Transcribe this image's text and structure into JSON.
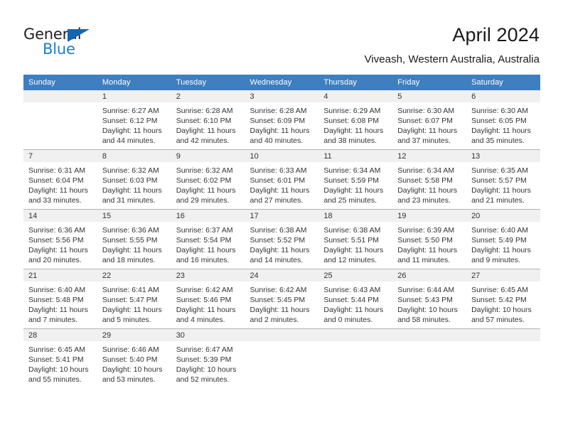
{
  "brand": {
    "name_top": "General",
    "name_bottom": "Blue",
    "accent_color": "#1565b0",
    "accent_color_text": "#1a7ed0"
  },
  "header": {
    "title": "April 2024",
    "subtitle": "Viveash, Western Australia, Australia"
  },
  "theme": {
    "header_row_bg": "#3d7fc1",
    "daynum_band_bg": "#f0f0f0",
    "cell_bg": "#ffffff",
    "border_color": "#b5b5b5",
    "text_color": "#333333"
  },
  "weekday_headers": [
    "Sunday",
    "Monday",
    "Tuesday",
    "Wednesday",
    "Thursday",
    "Friday",
    "Saturday"
  ],
  "weeks": [
    [
      {
        "day": "",
        "sunrise": "",
        "sunset": "",
        "daylight_line1": "",
        "daylight_line2": ""
      },
      {
        "day": "1",
        "sunrise": "Sunrise: 6:27 AM",
        "sunset": "Sunset: 6:12 PM",
        "daylight_line1": "Daylight: 11 hours",
        "daylight_line2": "and 44 minutes."
      },
      {
        "day": "2",
        "sunrise": "Sunrise: 6:28 AM",
        "sunset": "Sunset: 6:10 PM",
        "daylight_line1": "Daylight: 11 hours",
        "daylight_line2": "and 42 minutes."
      },
      {
        "day": "3",
        "sunrise": "Sunrise: 6:28 AM",
        "sunset": "Sunset: 6:09 PM",
        "daylight_line1": "Daylight: 11 hours",
        "daylight_line2": "and 40 minutes."
      },
      {
        "day": "4",
        "sunrise": "Sunrise: 6:29 AM",
        "sunset": "Sunset: 6:08 PM",
        "daylight_line1": "Daylight: 11 hours",
        "daylight_line2": "and 38 minutes."
      },
      {
        "day": "5",
        "sunrise": "Sunrise: 6:30 AM",
        "sunset": "Sunset: 6:07 PM",
        "daylight_line1": "Daylight: 11 hours",
        "daylight_line2": "and 37 minutes."
      },
      {
        "day": "6",
        "sunrise": "Sunrise: 6:30 AM",
        "sunset": "Sunset: 6:05 PM",
        "daylight_line1": "Daylight: 11 hours",
        "daylight_line2": "and 35 minutes."
      }
    ],
    [
      {
        "day": "7",
        "sunrise": "Sunrise: 6:31 AM",
        "sunset": "Sunset: 6:04 PM",
        "daylight_line1": "Daylight: 11 hours",
        "daylight_line2": "and 33 minutes."
      },
      {
        "day": "8",
        "sunrise": "Sunrise: 6:32 AM",
        "sunset": "Sunset: 6:03 PM",
        "daylight_line1": "Daylight: 11 hours",
        "daylight_line2": "and 31 minutes."
      },
      {
        "day": "9",
        "sunrise": "Sunrise: 6:32 AM",
        "sunset": "Sunset: 6:02 PM",
        "daylight_line1": "Daylight: 11 hours",
        "daylight_line2": "and 29 minutes."
      },
      {
        "day": "10",
        "sunrise": "Sunrise: 6:33 AM",
        "sunset": "Sunset: 6:01 PM",
        "daylight_line1": "Daylight: 11 hours",
        "daylight_line2": "and 27 minutes."
      },
      {
        "day": "11",
        "sunrise": "Sunrise: 6:34 AM",
        "sunset": "Sunset: 5:59 PM",
        "daylight_line1": "Daylight: 11 hours",
        "daylight_line2": "and 25 minutes."
      },
      {
        "day": "12",
        "sunrise": "Sunrise: 6:34 AM",
        "sunset": "Sunset: 5:58 PM",
        "daylight_line1": "Daylight: 11 hours",
        "daylight_line2": "and 23 minutes."
      },
      {
        "day": "13",
        "sunrise": "Sunrise: 6:35 AM",
        "sunset": "Sunset: 5:57 PM",
        "daylight_line1": "Daylight: 11 hours",
        "daylight_line2": "and 21 minutes."
      }
    ],
    [
      {
        "day": "14",
        "sunrise": "Sunrise: 6:36 AM",
        "sunset": "Sunset: 5:56 PM",
        "daylight_line1": "Daylight: 11 hours",
        "daylight_line2": "and 20 minutes."
      },
      {
        "day": "15",
        "sunrise": "Sunrise: 6:36 AM",
        "sunset": "Sunset: 5:55 PM",
        "daylight_line1": "Daylight: 11 hours",
        "daylight_line2": "and 18 minutes."
      },
      {
        "day": "16",
        "sunrise": "Sunrise: 6:37 AM",
        "sunset": "Sunset: 5:54 PM",
        "daylight_line1": "Daylight: 11 hours",
        "daylight_line2": "and 16 minutes."
      },
      {
        "day": "17",
        "sunrise": "Sunrise: 6:38 AM",
        "sunset": "Sunset: 5:52 PM",
        "daylight_line1": "Daylight: 11 hours",
        "daylight_line2": "and 14 minutes."
      },
      {
        "day": "18",
        "sunrise": "Sunrise: 6:38 AM",
        "sunset": "Sunset: 5:51 PM",
        "daylight_line1": "Daylight: 11 hours",
        "daylight_line2": "and 12 minutes."
      },
      {
        "day": "19",
        "sunrise": "Sunrise: 6:39 AM",
        "sunset": "Sunset: 5:50 PM",
        "daylight_line1": "Daylight: 11 hours",
        "daylight_line2": "and 11 minutes."
      },
      {
        "day": "20",
        "sunrise": "Sunrise: 6:40 AM",
        "sunset": "Sunset: 5:49 PM",
        "daylight_line1": "Daylight: 11 hours",
        "daylight_line2": "and 9 minutes."
      }
    ],
    [
      {
        "day": "21",
        "sunrise": "Sunrise: 6:40 AM",
        "sunset": "Sunset: 5:48 PM",
        "daylight_line1": "Daylight: 11 hours",
        "daylight_line2": "and 7 minutes."
      },
      {
        "day": "22",
        "sunrise": "Sunrise: 6:41 AM",
        "sunset": "Sunset: 5:47 PM",
        "daylight_line1": "Daylight: 11 hours",
        "daylight_line2": "and 5 minutes."
      },
      {
        "day": "23",
        "sunrise": "Sunrise: 6:42 AM",
        "sunset": "Sunset: 5:46 PM",
        "daylight_line1": "Daylight: 11 hours",
        "daylight_line2": "and 4 minutes."
      },
      {
        "day": "24",
        "sunrise": "Sunrise: 6:42 AM",
        "sunset": "Sunset: 5:45 PM",
        "daylight_line1": "Daylight: 11 hours",
        "daylight_line2": "and 2 minutes."
      },
      {
        "day": "25",
        "sunrise": "Sunrise: 6:43 AM",
        "sunset": "Sunset: 5:44 PM",
        "daylight_line1": "Daylight: 11 hours",
        "daylight_line2": "and 0 minutes."
      },
      {
        "day": "26",
        "sunrise": "Sunrise: 6:44 AM",
        "sunset": "Sunset: 5:43 PM",
        "daylight_line1": "Daylight: 10 hours",
        "daylight_line2": "and 58 minutes."
      },
      {
        "day": "27",
        "sunrise": "Sunrise: 6:45 AM",
        "sunset": "Sunset: 5:42 PM",
        "daylight_line1": "Daylight: 10 hours",
        "daylight_line2": "and 57 minutes."
      }
    ],
    [
      {
        "day": "28",
        "sunrise": "Sunrise: 6:45 AM",
        "sunset": "Sunset: 5:41 PM",
        "daylight_line1": "Daylight: 10 hours",
        "daylight_line2": "and 55 minutes."
      },
      {
        "day": "29",
        "sunrise": "Sunrise: 6:46 AM",
        "sunset": "Sunset: 5:40 PM",
        "daylight_line1": "Daylight: 10 hours",
        "daylight_line2": "and 53 minutes."
      },
      {
        "day": "30",
        "sunrise": "Sunrise: 6:47 AM",
        "sunset": "Sunset: 5:39 PM",
        "daylight_line1": "Daylight: 10 hours",
        "daylight_line2": "and 52 minutes."
      },
      {
        "day": "",
        "sunrise": "",
        "sunset": "",
        "daylight_line1": "",
        "daylight_line2": ""
      },
      {
        "day": "",
        "sunrise": "",
        "sunset": "",
        "daylight_line1": "",
        "daylight_line2": ""
      },
      {
        "day": "",
        "sunrise": "",
        "sunset": "",
        "daylight_line1": "",
        "daylight_line2": ""
      },
      {
        "day": "",
        "sunrise": "",
        "sunset": "",
        "daylight_line1": "",
        "daylight_line2": ""
      }
    ]
  ]
}
